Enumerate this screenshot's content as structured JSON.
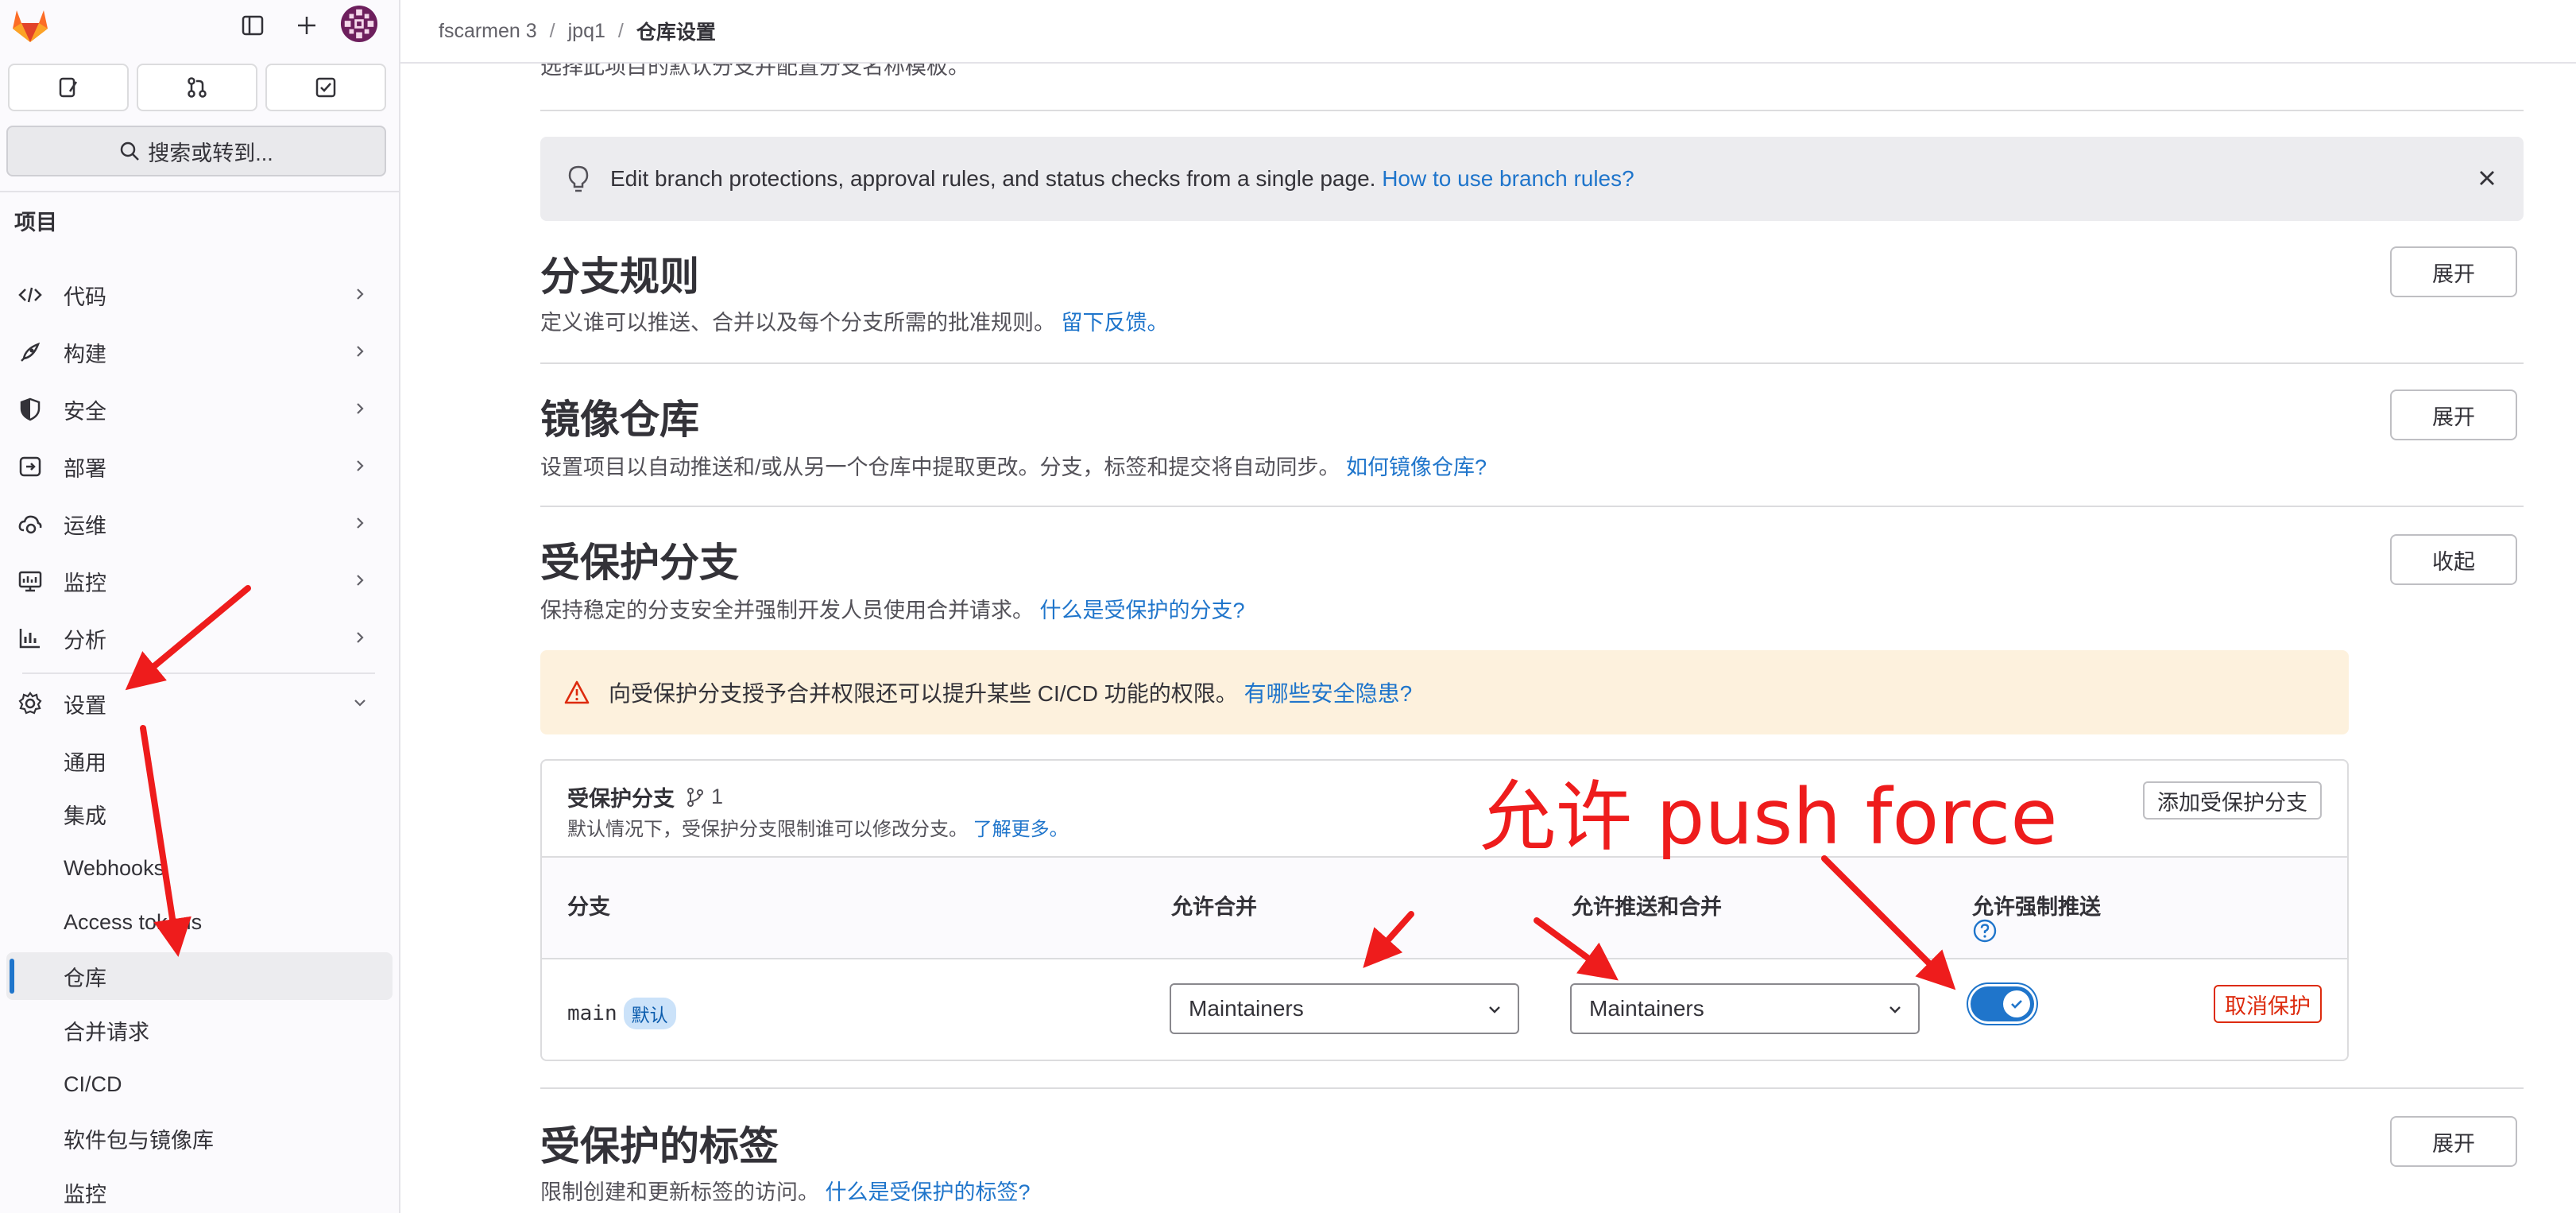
{
  "topbar": {
    "breadcrumbs": [
      "fscarmen 3",
      "jpq1",
      "仓库设置"
    ]
  },
  "sidebar": {
    "search_label": "搜索或转到...",
    "section_label": "项目",
    "nav_items": [
      {
        "label": "代码",
        "icon": "code-icon"
      },
      {
        "label": "构建",
        "icon": "rocket-icon"
      },
      {
        "label": "安全",
        "icon": "shield-icon"
      },
      {
        "label": "部署",
        "icon": "deployments-icon"
      },
      {
        "label": "运维",
        "icon": "cloud-gear-icon"
      },
      {
        "label": "监控",
        "icon": "monitor-icon"
      },
      {
        "label": "分析",
        "icon": "chart-icon"
      },
      {
        "label": "设置",
        "icon": "gear-icon"
      }
    ],
    "settings_subitems": [
      {
        "label": "通用"
      },
      {
        "label": "集成"
      },
      {
        "label": "Webhooks"
      },
      {
        "label": "Access tokens"
      },
      {
        "label": "仓库",
        "active": true
      },
      {
        "label": "合并请求"
      },
      {
        "label": "CI/CD"
      },
      {
        "label": "软件包与镜像库"
      },
      {
        "label": "监控"
      }
    ]
  },
  "main": {
    "cut_text": "选择此项目的默认分支并配置分支名称模板。",
    "alert": {
      "text": "Edit branch protections, approval rules, and status checks from a single page.",
      "link": "How to use branch rules?"
    },
    "branch_rules": {
      "title": "分支规则",
      "desc": "定义谁可以推送、合并以及每个分支所需的批准规则。",
      "link": "留下反馈。",
      "button": "展开"
    },
    "mirror": {
      "title": "镜像仓库",
      "desc": "设置项目以自动推送和/或从另一个仓库中提取更改。分支，标签和提交将自动同步。",
      "link": "如何镜像仓库?",
      "button": "展开"
    },
    "protected_branches": {
      "title": "受保护分支",
      "desc": "保持稳定的分支安全并强制开发人员使用合并请求。",
      "link": "什么是受保护的分支?",
      "button": "收起",
      "warning": {
        "text": "向受保护分支授予合并权限还可以提升某些 CI/CD 功能的权限。",
        "link": "有哪些安全隐患?"
      },
      "card": {
        "title": "受保护分支",
        "count": "1",
        "subtitle": "默认情况下，受保护分支限制谁可以修改分支。",
        "subtitle_link": "了解更多。",
        "add_button": "添加受保护分支",
        "columns": [
          "分支",
          "允许合并",
          "允许推送和合并",
          "允许强制推送"
        ],
        "row": {
          "branch": "main",
          "badge": "默认",
          "allowed_to_merge": "Maintainers",
          "allowed_to_push": "Maintainers",
          "force_push_enabled": true,
          "unprotect_button": "取消保护"
        }
      }
    },
    "protected_tags": {
      "title": "受保护的标签",
      "desc": "限制创建和更新标签的访问。",
      "link": "什么是受保护的标签?",
      "button": "展开"
    }
  },
  "annotation": {
    "text": "允许 push force",
    "color": "#ee1c1c"
  },
  "colors": {
    "link": "#1f75cb",
    "danger": "#dd2b0e",
    "warning_bg": "#fdf1dd",
    "alert_bg": "#ececef"
  }
}
